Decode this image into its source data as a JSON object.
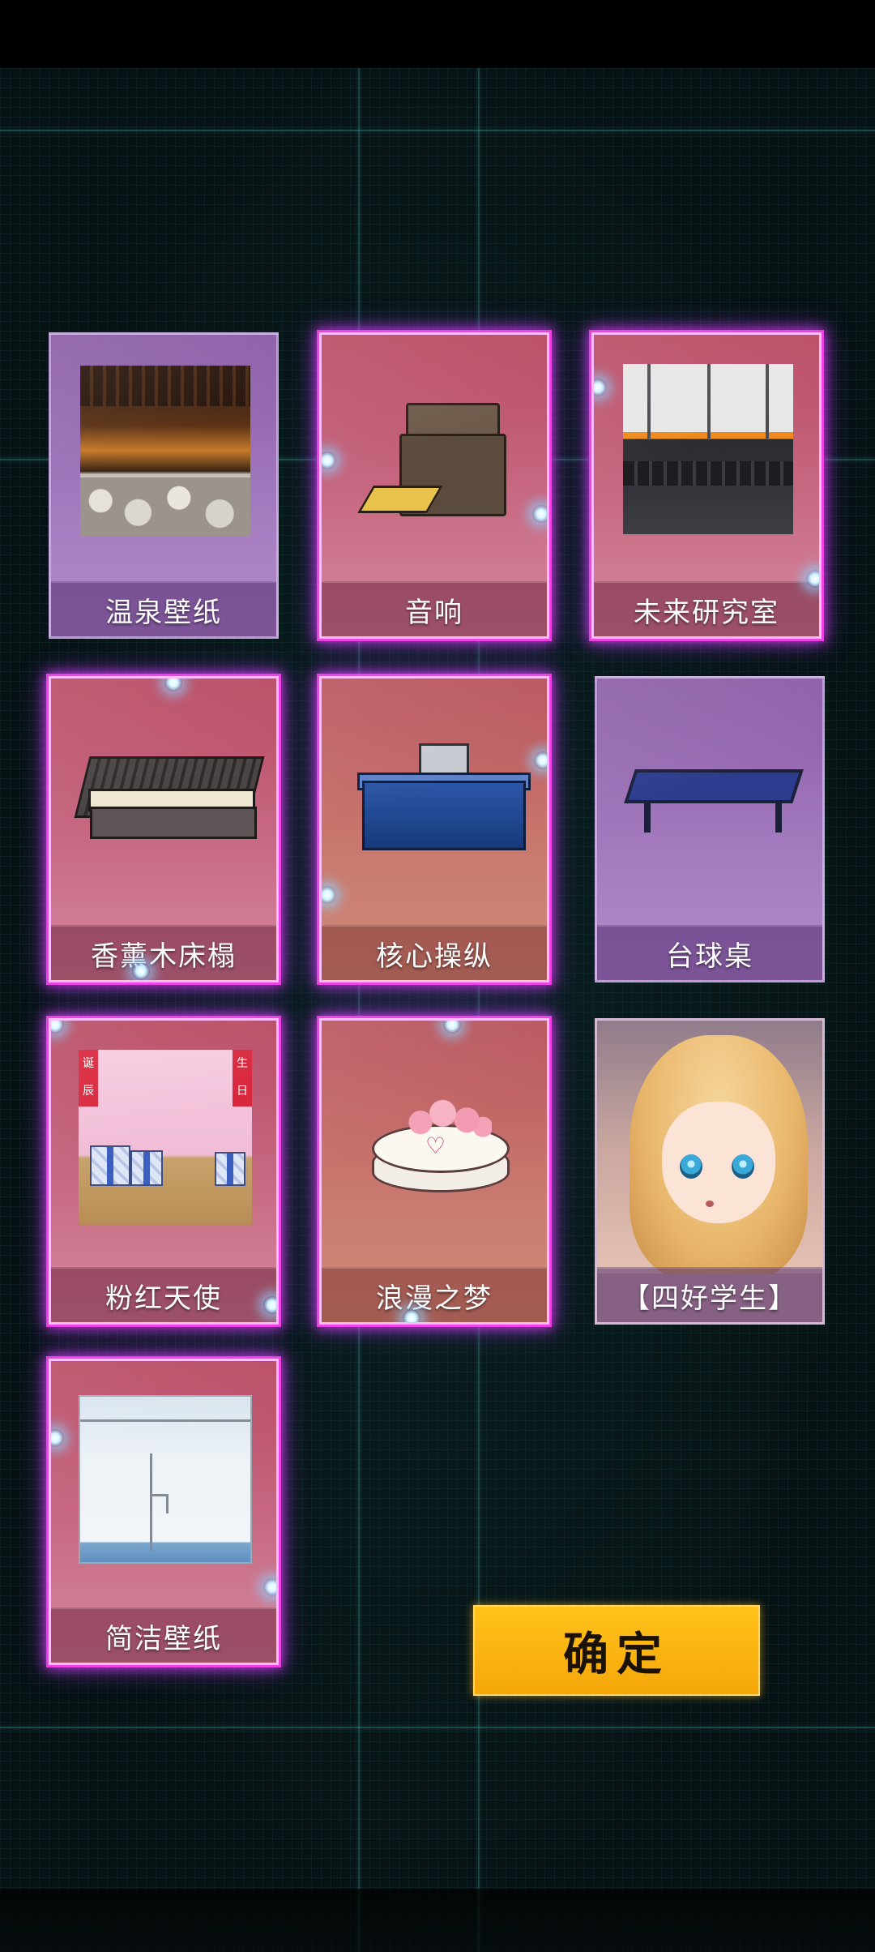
{
  "items": [
    {
      "label": "温泉壁纸"
    },
    {
      "label": "音响"
    },
    {
      "label": "未来研究室"
    },
    {
      "label": "香薰木床榻"
    },
    {
      "label": "核心操纵"
    },
    {
      "label": "台球桌"
    },
    {
      "label": "粉红天使"
    },
    {
      "label": "浪漫之梦"
    },
    {
      "label": "【四好学生】"
    },
    {
      "label": "简洁壁纸"
    }
  ],
  "confirm_label": "确定",
  "colors": {
    "confirm": "#ffc21a",
    "card_pink": "#c86a84",
    "card_purple": "#a57cc0",
    "selection_glow": "#e63cff"
  },
  "angel_thumb_text": {
    "left": "诞辰",
    "right": "生日"
  }
}
